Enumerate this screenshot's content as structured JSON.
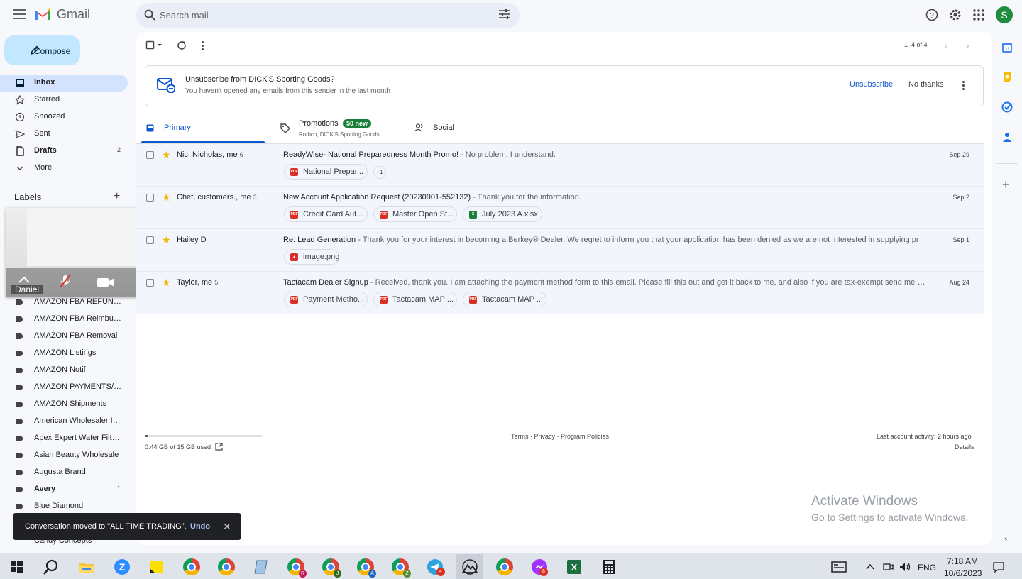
{
  "header": {
    "app_name": "Gmail",
    "search_placeholder": "Search mail",
    "avatar_letter": "S"
  },
  "sidebar": {
    "compose_label": "Compose",
    "items": [
      {
        "label": "Inbox",
        "icon": "inbox-icon",
        "count": "",
        "active": true
      },
      {
        "label": "Starred",
        "icon": "star-icon",
        "count": ""
      },
      {
        "label": "Snoozed",
        "icon": "clock-icon",
        "count": ""
      },
      {
        "label": "Sent",
        "icon": "send-icon",
        "count": ""
      },
      {
        "label": "Drafts",
        "icon": "draft-icon",
        "count": "2"
      },
      {
        "label": "More",
        "icon": "chevron-down-icon",
        "count": ""
      }
    ],
    "labels_title": "Labels",
    "labels": [
      {
        "label": "AMAZON FBA REFUNDS",
        "count": ""
      },
      {
        "label": "AMAZON FBA Reimburs...",
        "count": ""
      },
      {
        "label": "AMAZON FBA Removal",
        "count": ""
      },
      {
        "label": "AMAZON Listings",
        "count": ""
      },
      {
        "label": "AMAZON Notif",
        "count": ""
      },
      {
        "label": "AMAZON PAYMENTS/SE...",
        "count": ""
      },
      {
        "label": "AMAZON Shipments",
        "count": ""
      },
      {
        "label": "American Wholesaler In...",
        "count": ""
      },
      {
        "label": "Apex Expert Water Filters",
        "count": ""
      },
      {
        "label": "Asian Beauty Wholesale",
        "count": ""
      },
      {
        "label": "Augusta Brand",
        "count": ""
      },
      {
        "label": "Avery",
        "count": "1"
      },
      {
        "label": "Blue Diamond",
        "count": ""
      }
    ],
    "partial_label": "Candy Concepts"
  },
  "video_call": {
    "participant": "Daniel"
  },
  "toolbar": {
    "pager": "1–4 of 4"
  },
  "unsubscribe": {
    "title": "Unsubscribe from DICK'S Sporting Goods?",
    "subtitle": "You haven't opened any emails from this sender in the last month",
    "unsubscribe_label": "Unsubscribe",
    "no_thanks_label": "No thanks"
  },
  "tabs": [
    {
      "label": "Primary",
      "icon": "inbox-icon"
    },
    {
      "label": "Promotions",
      "icon": "tag-icon",
      "badge": "50 new",
      "sub": "Rothco, DICK'S Sporting Goods,..."
    },
    {
      "label": "Social",
      "icon": "people-icon"
    }
  ],
  "emails": [
    {
      "sender": "Nic, Nicholas, me",
      "count": "6",
      "subject": "ReadyWise- National Preparedness Month Promo!",
      "snippet": " - No problem, I understand.",
      "date": "Sep 29",
      "attachments": [
        {
          "name": "National Prepar...",
          "type": "pdf"
        }
      ],
      "more": "+1"
    },
    {
      "sender": "Chef, customers., me",
      "count": "3",
      "subject": "New Account Application Request (20230901-552132)",
      "snippet": " - Thank you for the information.",
      "date": "Sep 2",
      "attachments": [
        {
          "name": "Credit Card Aut...",
          "type": "pdf"
        },
        {
          "name": "Master Open St...",
          "type": "pdf"
        },
        {
          "name": "July 2023 A.xlsx",
          "type": "xls"
        }
      ]
    },
    {
      "sender": "Hailey D",
      "count": "",
      "subject": "Re: Lead Generation",
      "snippet": " - Thank you for your interest in becoming a Berkey® Dealer. We regret to inform you that your application has been denied as we are not interested in supplying pr",
      "date": "Sep 1",
      "attachments": [
        {
          "name": "image.png",
          "type": "img"
        }
      ]
    },
    {
      "sender": "Taylor, me",
      "count": "5",
      "subject": "Tactacam Dealer Signup",
      "snippet": " - Received, thank you. I am attaching the payment method form to this email. Please fill this out and get it back to me, and also if you are tax-exempt send me your ...",
      "date": "Aug 24",
      "attachments": [
        {
          "name": "Payment Metho...",
          "type": "pdf"
        },
        {
          "name": "Tactacam MAP ...",
          "type": "pdf"
        },
        {
          "name": "Tactacam MAP ...",
          "type": "pdf"
        }
      ]
    }
  ],
  "footer": {
    "storage": "0.44 GB of 15 GB used",
    "storage_fraction": 0.029,
    "links": "Terms · Privacy · Program Policies",
    "last_activity": "Last account activity: 2 hours ago",
    "details": "Details"
  },
  "watermark": {
    "line1": "Activate Windows",
    "line2": "Go to Settings to activate Windows."
  },
  "snackbar": {
    "message": "Conversation moved to \"ALL TIME TRADING\".",
    "undo": "Undo"
  },
  "taskbar": {
    "language": "ENG",
    "time": "7:18 AM",
    "date": "10/6/2023",
    "apps": [
      "windows-start-icon",
      "search-icon",
      "file-explorer-icon",
      "zoom-icon",
      "sticky-notes-icon",
      "chrome-icon",
      "chrome-icon",
      "notepad-icon",
      "chrome-r-icon",
      "chrome-j-icon",
      "chrome-a-icon",
      "chrome-z-icon",
      "telegram-icon",
      "photos-icon",
      "chrome-icon",
      "messenger-icon",
      "excel-icon",
      "calculator-icon"
    ],
    "telegram_badge": "4",
    "messenger_badge": "8"
  }
}
